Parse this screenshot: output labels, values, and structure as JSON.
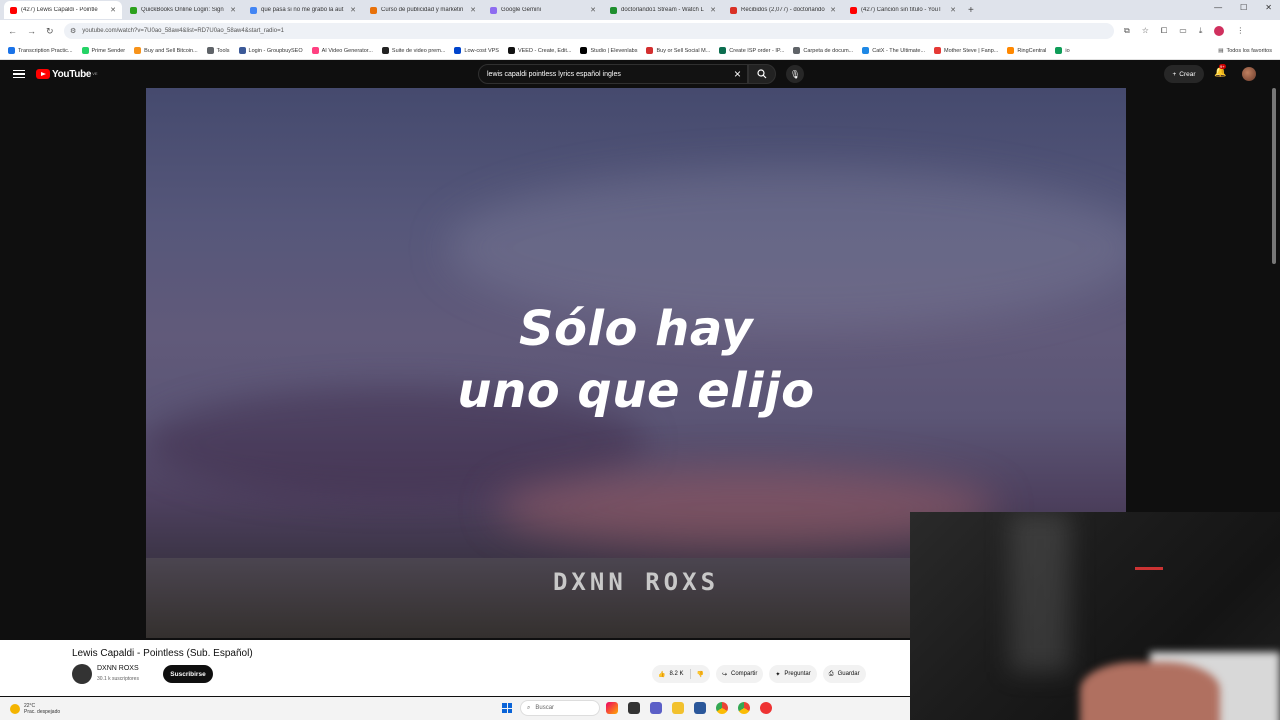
{
  "browser": {
    "tabs": [
      {
        "title": "(427) Lewis Capaldi - Pointle",
        "favicon_color": "#ff0000",
        "active": true
      },
      {
        "title": "QuickBooks Online Login: Sign",
        "favicon_color": "#2ca01c",
        "active": false
      },
      {
        "title": "que pasa si no me grabo la aut",
        "favicon_color": "#4285f4",
        "active": false
      },
      {
        "title": "Curso de publicidad y marketin",
        "favicon_color": "#e8710a",
        "active": false
      },
      {
        "title": "Google Gemini",
        "favicon_color": "#8e6cf0",
        "active": false
      },
      {
        "title": "doctorlando1 Stream - Watch L",
        "favicon_color": "#1f8f2f",
        "active": false
      },
      {
        "title": "Recibidos (2,077) - doctorlando",
        "favicon_color": "#d93025",
        "active": false
      },
      {
        "title": "(427) Canción sin título - YouT",
        "favicon_color": "#ff0000",
        "active": false
      }
    ],
    "url": "youtube.com/watch?v=7U0ao_58aw4&list=RD7U0ao_58aw4&start_radio=1",
    "bookmarks": [
      {
        "label": "Transcription Practic...",
        "color": "#1a73e8"
      },
      {
        "label": "Prime Sender",
        "color": "#25d366"
      },
      {
        "label": "Buy and Sell Bitcoin...",
        "color": "#f7931a"
      },
      {
        "label": "Tools",
        "color": "#5f6368"
      },
      {
        "label": "Login - GroupbuySEO",
        "color": "#3b5998"
      },
      {
        "label": "AI Video Generator...",
        "color": "#ff4081"
      },
      {
        "label": "Suite de video prem...",
        "color": "#222222"
      },
      {
        "label": "Low-cost VPS",
        "color": "#0044cc"
      },
      {
        "label": "VEED - Create, Edit...",
        "color": "#111111"
      },
      {
        "label": "Studio | Elevenlabs",
        "color": "#000000"
      },
      {
        "label": "Buy or Sell Social M...",
        "color": "#d32f2f"
      },
      {
        "label": "Create ISP order - IP...",
        "color": "#0b6e4f"
      },
      {
        "label": "Carpeta de docum...",
        "color": "#5f6368"
      },
      {
        "label": "CatX - The Ultimate...",
        "color": "#1e88e5"
      },
      {
        "label": "Mother Steve | Fanp...",
        "color": "#e53935"
      },
      {
        "label": "RingCentral",
        "color": "#ff8800"
      },
      {
        "label": "io",
        "color": "#0f9d58"
      }
    ],
    "bookmarks_right": "Todos los favoritos"
  },
  "youtube": {
    "logo_text": "YouTube",
    "country_code": "VE",
    "search_query": "lewis capaldi pointless lyrics español ingles",
    "create_label": "Crear",
    "notif_count": "9+",
    "player": {
      "lyric_line1": "Sólo hay",
      "lyric_line2": "uno que elijo",
      "watermark": "DXNN ROXS"
    },
    "video": {
      "title": "Lewis Capaldi - Pointless (Sub. Español)",
      "channel": "DXNN ROXS",
      "subscribers": "30.1 k suscriptores",
      "subscribe_label": "Suscribirse",
      "likes": "8.2 K",
      "share_label": "Compartir",
      "ask_label": "Preguntar",
      "save_label": "Guardar"
    }
  },
  "taskbar": {
    "temp": "22°C",
    "weather": "Prac. despejado",
    "search_placeholder": "Buscar"
  }
}
